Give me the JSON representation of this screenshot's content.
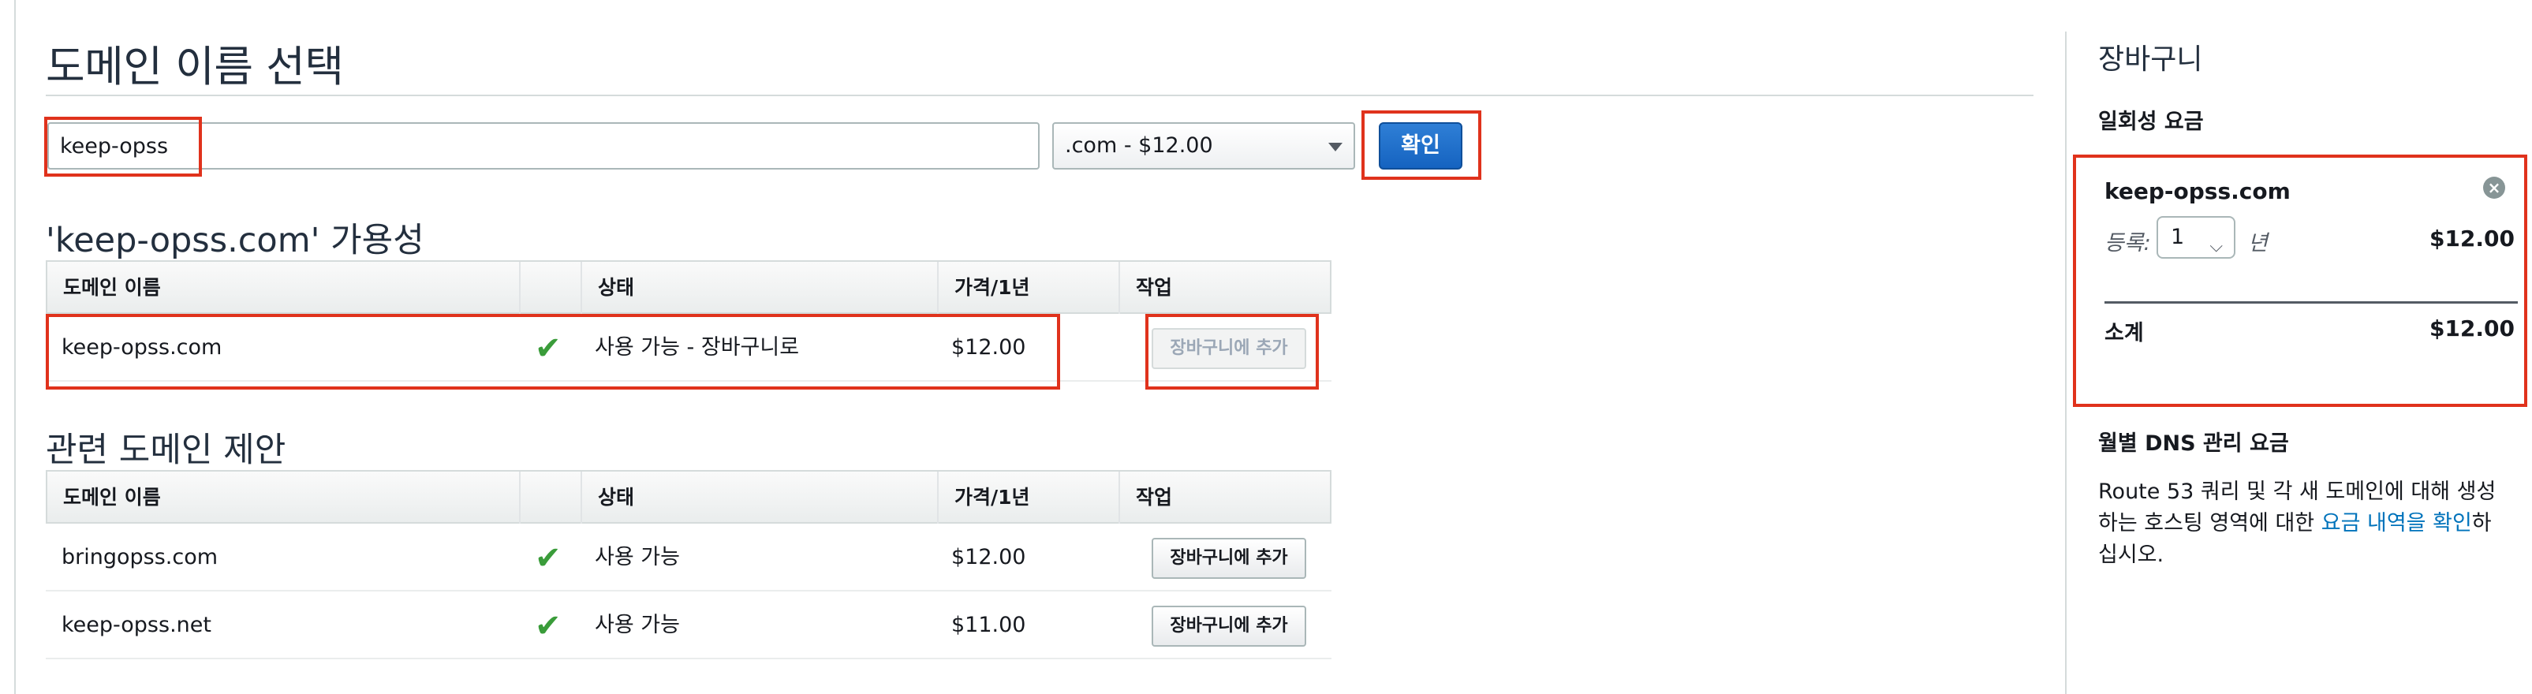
{
  "page": {
    "title": "도메인 이름 선택"
  },
  "search": {
    "value": "keep-opss",
    "tld_selected": ".com - $12.00",
    "check_label": "확인"
  },
  "availability": {
    "title": "'keep-opss.com' 가용성",
    "headers": [
      "도메인 이름",
      "",
      "상태",
      "가격/1년",
      "작업"
    ],
    "rows": [
      {
        "domain": "keep-opss.com",
        "status": "사용 가능 - 장바구니로",
        "price": "$12.00",
        "action": "장바구니에 추가",
        "action_disabled": true
      }
    ]
  },
  "related": {
    "title": "관련 도메인 제안",
    "headers": [
      "도메인 이름",
      "",
      "상태",
      "가격/1년",
      "작업"
    ],
    "rows": [
      {
        "domain": "bringopss.com",
        "status": "사용 가능",
        "price": "$12.00",
        "action": "장바구니에 추가"
      },
      {
        "domain": "keep-opss.net",
        "status": "사용 가능",
        "price": "$11.00",
        "action": "장바구니에 추가"
      }
    ]
  },
  "cart": {
    "title": "장바구니",
    "one_time_label": "일회성 요금",
    "item": {
      "domain": "keep-opss.com",
      "register_label": "등록:",
      "years": "1",
      "years_unit": "년",
      "price": "$12.00"
    },
    "subtotal_label": "소계",
    "subtotal_value": "$12.00",
    "dns_title": "월별 DNS 관리 요금",
    "dns_text_before": "Route 53 쿼리 및 각 새 도메인에 대해 생성하는 호스팅 영역에 대한 ",
    "dns_link": "요금 내역을 확인",
    "dns_text_after": "하십시오."
  },
  "colors": {
    "highlight": "#e0321c",
    "primary_button": "#1563c0",
    "check": "#3a9c3a",
    "link": "#0073bb"
  },
  "icons": {
    "available": "check-icon",
    "remove": "remove-circle-icon",
    "dropdown": "chevron-down-icon"
  }
}
